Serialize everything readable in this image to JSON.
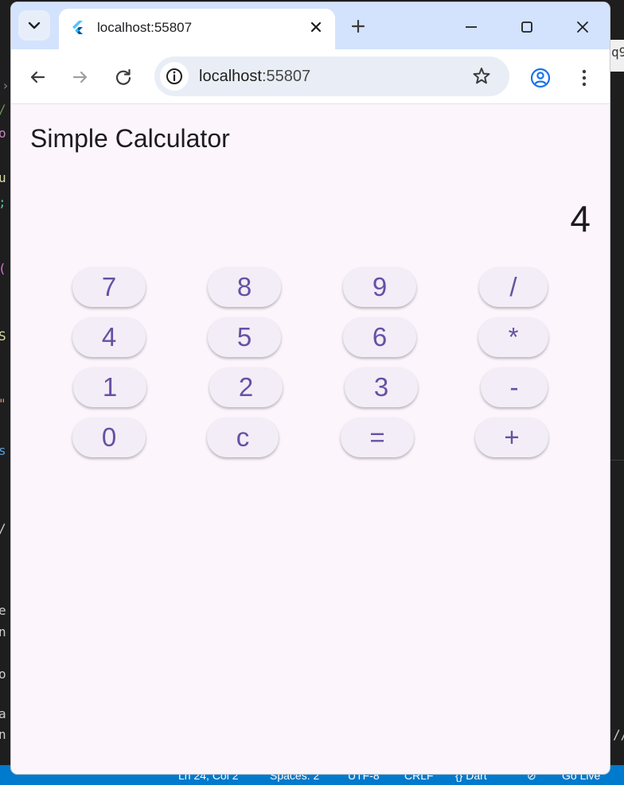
{
  "browser": {
    "tab_title": "localhost:55807",
    "url_host": "localhost",
    "url_port": ":55807"
  },
  "app": {
    "title": "Simple Calculator",
    "display_value": "4"
  },
  "keypad": {
    "rows": [
      [
        "7",
        "8",
        "9",
        "/"
      ],
      [
        "4",
        "5",
        "6",
        "*"
      ],
      [
        "1",
        "2",
        "3",
        "-"
      ],
      [
        "0",
        "c",
        "=",
        "+"
      ]
    ]
  },
  "background_editor": {
    "statusbar": [
      "Ln 24, Col 2",
      "Spaces: 2",
      "UTF-8",
      "CRLF",
      "{} Dart",
      "Go Live"
    ],
    "right_edge_text": "q9",
    "right_edge_text_2": "//"
  },
  "colors": {
    "page_bg": "#fcf5fc",
    "button_bg": "#f2edf6",
    "button_text": "#6750a4",
    "titlebar_bg": "#d3e3fd",
    "statusbar_bg": "#007acc"
  },
  "icons": {
    "tab_search": "chevron-down-icon",
    "favicon": "flutter-icon",
    "tab_close": "close-icon",
    "new_tab": "plus-icon",
    "back": "arrow-left-icon",
    "forward": "arrow-right-icon",
    "reload": "reload-icon",
    "site_info": "info-icon",
    "bookmark": "star-icon",
    "profile": "profile-icon",
    "menu": "kebab-menu-icon"
  }
}
